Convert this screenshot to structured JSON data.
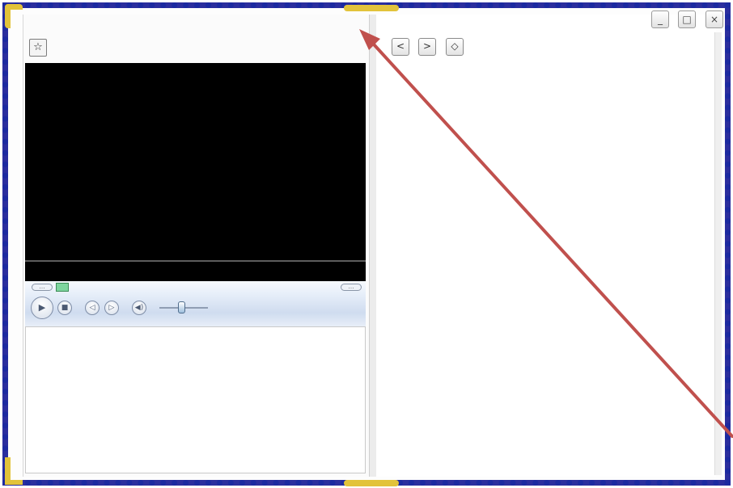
{
  "toolbar": {
    "favorite_icon": "star-icon",
    "favorite_glyph": "☆"
  },
  "player": {
    "seek_left_label": "…",
    "seek_right_label": "…",
    "play_glyph": "▶",
    "stop_glyph": "■",
    "prev_glyph": "◁",
    "next_glyph": "▷",
    "mute_glyph": "◀)",
    "volume_level": 0.45
  },
  "navigation": {
    "back_glyph": "<",
    "forward_glyph": ">",
    "home_glyph": "◇"
  },
  "window_controls": {
    "minimize_glyph": "_",
    "maximize_glyph": "□",
    "close_glyph": "×"
  },
  "annotation": {
    "arrow_color": "#c0504d"
  }
}
